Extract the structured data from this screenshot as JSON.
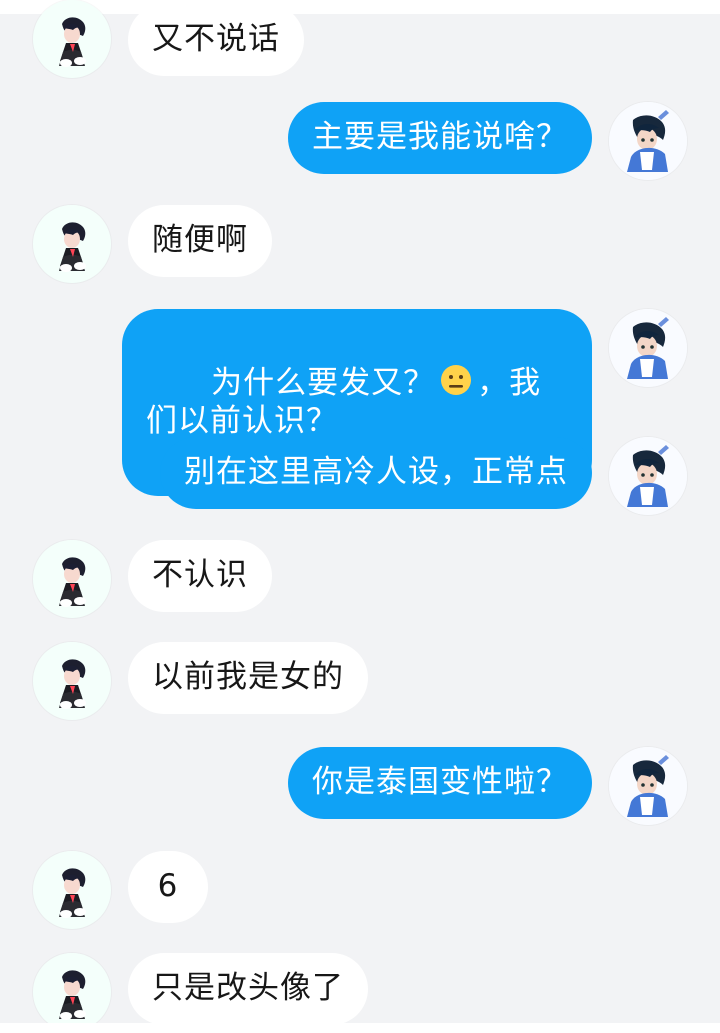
{
  "chat": {
    "messages": [
      {
        "sender": "other",
        "text": "又不说话"
      },
      {
        "sender": "self",
        "text": "主要是我能说啥？"
      },
      {
        "sender": "other",
        "text": "随便啊"
      },
      {
        "sender": "self",
        "text_before": "为什么要发又？",
        "emoji": "neutral-face-emoji",
        "text_after": "，我们以前认识？"
      },
      {
        "sender": "self",
        "text": "别在这里高冷人设，正常点"
      },
      {
        "sender": "other",
        "text": "不认识"
      },
      {
        "sender": "other",
        "text": "以前我是女的"
      },
      {
        "sender": "self",
        "text": "你是泰国变性啦？"
      },
      {
        "sender": "other",
        "text": "6"
      },
      {
        "sender": "other",
        "text": "只是改头像了"
      }
    ]
  },
  "colors": {
    "background": "#f2f3f5",
    "self_bubble": "#0fa2f6",
    "other_bubble": "#ffffff",
    "self_text": "#ffffff",
    "other_text": "#171717"
  },
  "icons": {
    "other_avatar": "dark-hair-character-avatar",
    "self_avatar": "blue-shirt-character-avatar",
    "emoji": "neutral-face-emoji"
  }
}
